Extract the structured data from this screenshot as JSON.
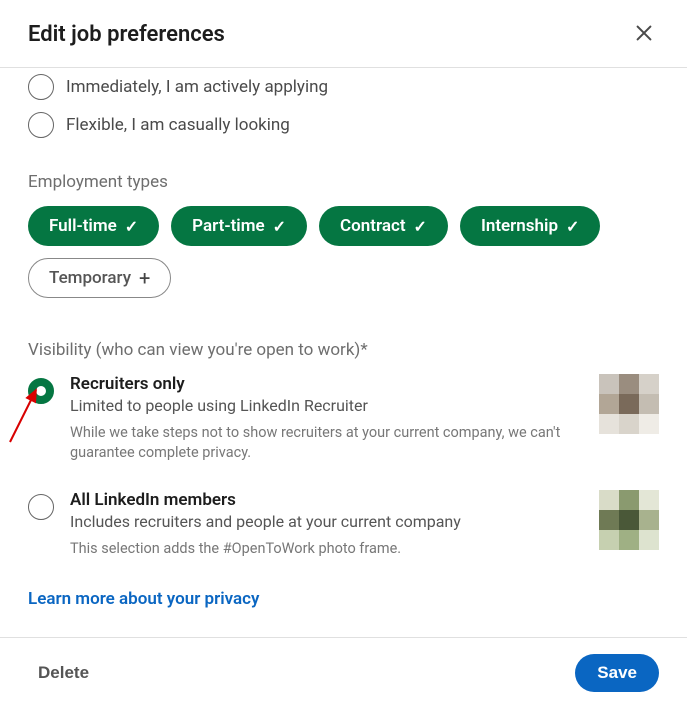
{
  "header": {
    "title": "Edit job preferences"
  },
  "start_date_options": [
    {
      "label": "Immediately, I am actively applying",
      "selected": false
    },
    {
      "label": "Flexible, I am casually looking",
      "selected": false
    }
  ],
  "employment_types": {
    "title": "Employment types",
    "items": [
      {
        "label": "Full-time",
        "selected": true
      },
      {
        "label": "Part-time",
        "selected": true
      },
      {
        "label": "Contract",
        "selected": true
      },
      {
        "label": "Internship",
        "selected": true
      },
      {
        "label": "Temporary",
        "selected": false
      }
    ]
  },
  "visibility": {
    "title": "Visibility (who can view you're open to work)*",
    "options": [
      {
        "heading": "Recruiters only",
        "sub": "Limited to people using LinkedIn Recruiter",
        "note": "While we take steps not to show recruiters at your current company, we can't guarantee complete privacy.",
        "selected": true
      },
      {
        "heading": "All LinkedIn members",
        "sub": "Includes recruiters and people at your current company",
        "note": "This selection adds the #OpenToWork photo frame.",
        "selected": false
      }
    ],
    "privacy_link": "Learn more about your privacy"
  },
  "footer": {
    "delete_label": "Delete",
    "save_label": "Save"
  }
}
